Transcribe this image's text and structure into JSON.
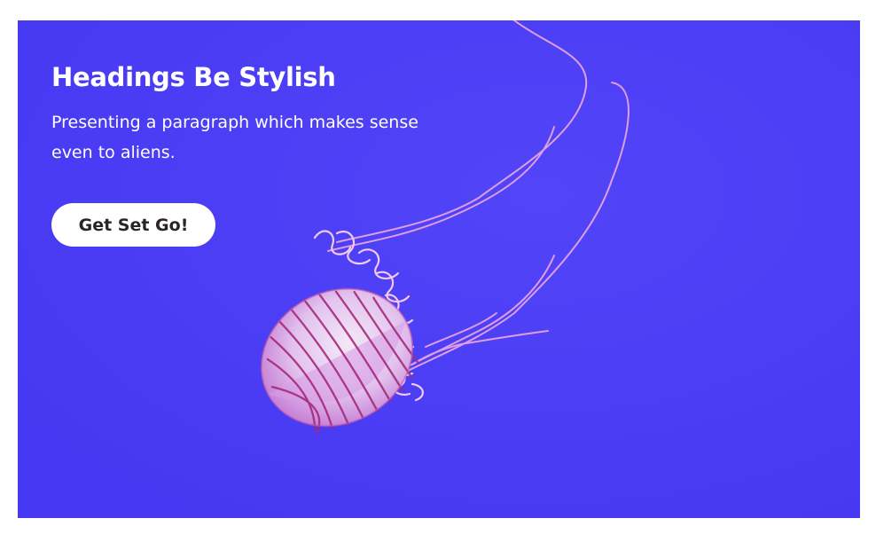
{
  "hero": {
    "heading": "Headings Be Stylish",
    "paragraph": "Presenting a paragraph which makes sense even to aliens.",
    "button_label": "Get Set Go!",
    "colors": {
      "background": "#4a3cf5",
      "jellyfish_bell": "#e9d6f2",
      "jellyfish_stripe": "#b0297d",
      "tentacle": "#f2b4e2"
    }
  }
}
